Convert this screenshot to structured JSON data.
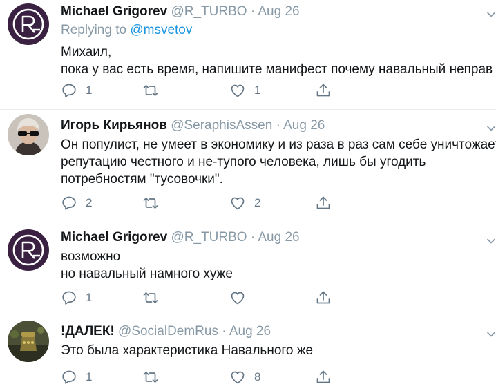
{
  "tweets": [
    {
      "name": "Michael Grigorev",
      "handle": "@R_TURBO",
      "date": "Aug 26",
      "replying_label": "Replying to",
      "replying_to": "@msvetov",
      "lines": [
        "Михаил,",
        "пока у вас есть время, напишите манифест почему навальный неправ"
      ],
      "reply_count": "1",
      "retweet_count": "",
      "like_count": "1",
      "avatar": "rg-logo"
    },
    {
      "name": "Игорь Кирьянов",
      "handle": "@SeraphisAssen",
      "date": "Aug 26",
      "lines": [
        "Он популист, не умеет в экономику и из раза в раз сам себе уничтожает",
        "репутацию честного и не-тупого человека, лишь бы угодить",
        "потребностям \"тусовочки\"."
      ],
      "reply_count": "2",
      "retweet_count": "",
      "like_count": "2",
      "avatar": "photo-sunglasses"
    },
    {
      "name": "Michael Grigorev",
      "handle": "@R_TURBO",
      "date": "Aug 26",
      "lines": [
        "возможно",
        "но навальный намного хуже"
      ],
      "reply_count": "1",
      "retweet_count": "",
      "like_count": "",
      "avatar": "rg-logo"
    },
    {
      "name": "!ДАЛЕК!",
      "handle": "@SocialDemRus",
      "date": "Aug 26",
      "lines": [
        "Это была характеристика Навального же"
      ],
      "reply_count": "1",
      "retweet_count": "",
      "like_count": "8",
      "avatar": "photo-dalek"
    }
  ],
  "dot": "·",
  "icons": [
    "reply-icon",
    "retweet-icon",
    "like-icon",
    "share-icon",
    "chevron-down-icon"
  ],
  "colors": {
    "name": "#14171a",
    "muted": "#8899a6",
    "link": "#1b95e0",
    "divider": "#e6ecf0",
    "logo_bg": "#3b2141"
  }
}
